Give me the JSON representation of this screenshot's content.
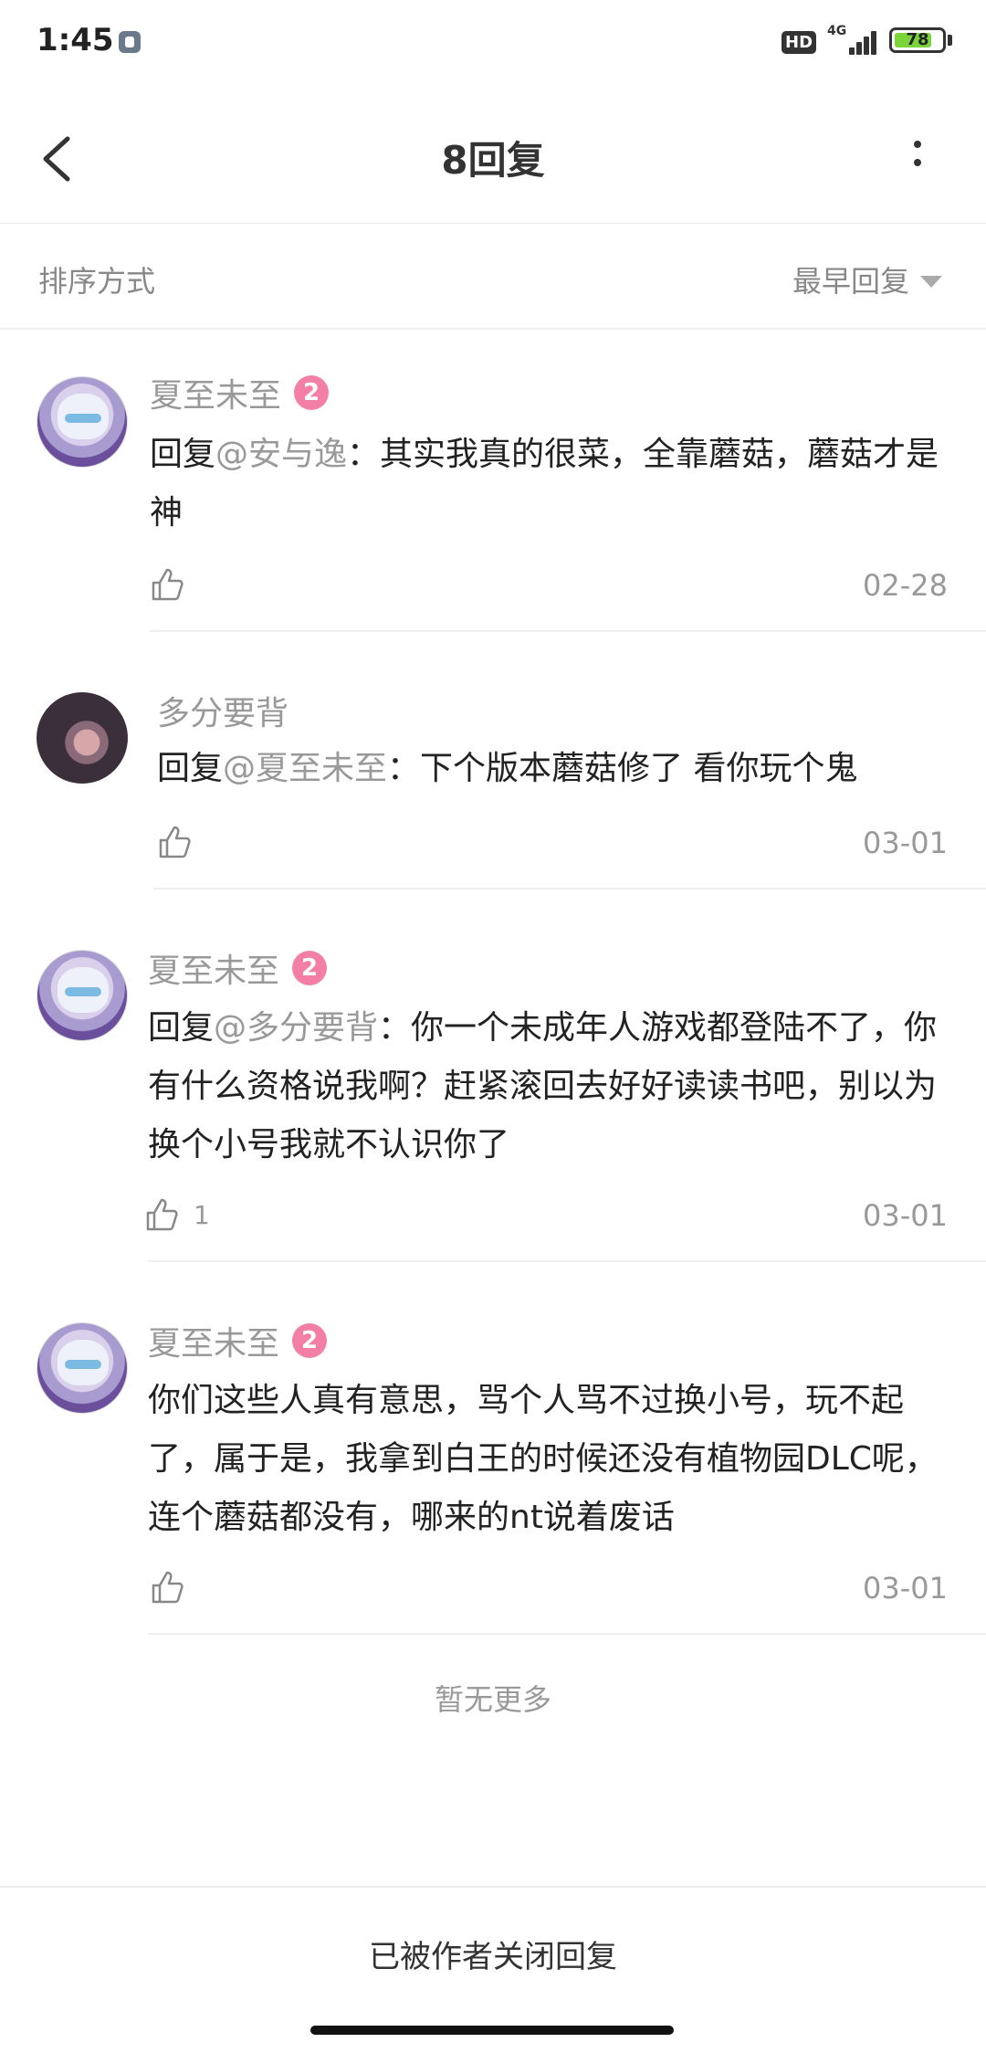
{
  "status_bar": {
    "time": "1:45",
    "hd": "HD",
    "network": "4G",
    "battery": "78"
  },
  "header": {
    "title": "8回复"
  },
  "sort": {
    "label": "排序方式",
    "value": "最早回复"
  },
  "replies": [
    {
      "username": "夏至未至",
      "level": "2",
      "reply_prefix": "回复",
      "mention": "@安与逸",
      "text": "：其实我真的很菜，全靠蘑菇，蘑菇才是神",
      "likes": "",
      "date": "02-28"
    },
    {
      "username": "多分要背",
      "level": "",
      "reply_prefix": "回复",
      "mention": "@夏至未至",
      "text": "：下个版本蘑菇修了 看你玩个鬼",
      "likes": "",
      "date": "03-01"
    },
    {
      "username": "夏至未至",
      "level": "2",
      "reply_prefix": "回复",
      "mention": "@多分要背",
      "text": "：你一个未成年人游戏都登陆不了，你有什么资格说我啊？赶紧滚回去好好读读书吧，别以为换个小号我就不认识你了",
      "likes": "1",
      "date": "03-01"
    },
    {
      "username": "夏至未至",
      "level": "2",
      "reply_prefix": "",
      "mention": "",
      "text": "你们这些人真有意思，骂个人骂不过换小号，玩不起了，属于是，我拿到白王的时候还没有植物园DLC呢，连个蘑菇都没有，哪来的nt说着废话",
      "likes": "",
      "date": "03-01"
    }
  ],
  "footer": {
    "no_more": "暂无更多",
    "closed": "已被作者关闭回复"
  },
  "icons": {
    "back": "back-arrow-icon",
    "more": "more-vertical-icon",
    "sort_caret": "caret-down-icon",
    "like": "thumbs-up-icon"
  },
  "colors": {
    "level_badge": "#f47fa6",
    "mention": "#999999",
    "battery_fill": "#7bd33a"
  }
}
